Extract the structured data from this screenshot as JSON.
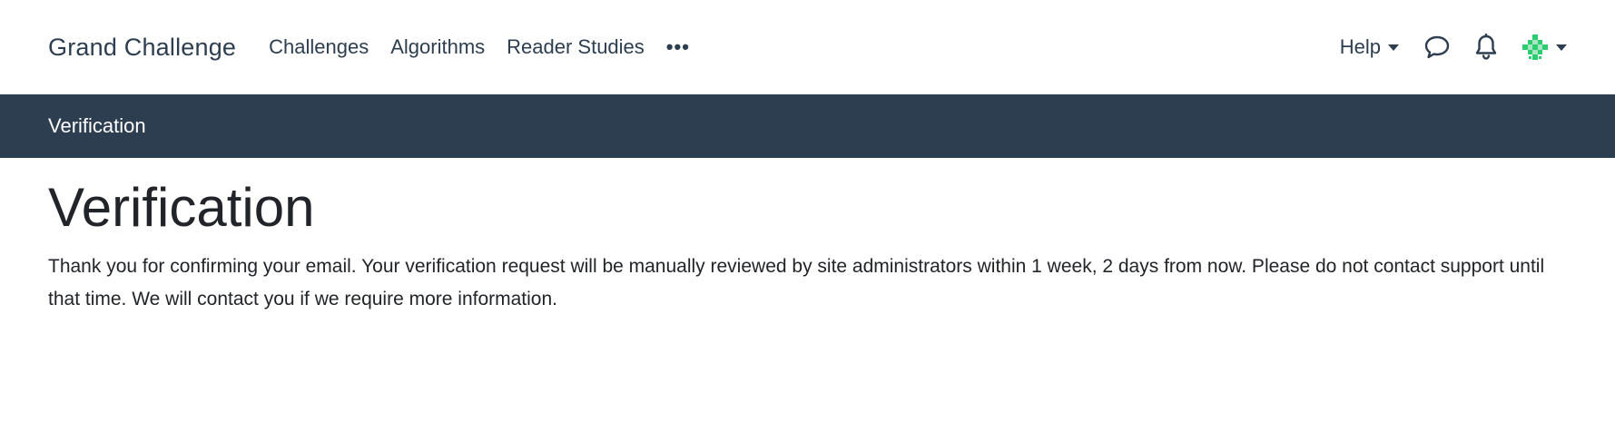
{
  "navbar": {
    "brand": "Grand Challenge",
    "links": [
      "Challenges",
      "Algorithms",
      "Reader Studies"
    ],
    "more": "•••",
    "help_label": "Help",
    "icons": {
      "forum": "chat-bubble-icon",
      "notifications": "bell-icon",
      "avatar": "user-avatar-icon"
    },
    "avatar_color": "#2ecc71"
  },
  "subbar": {
    "title": "Verification"
  },
  "main": {
    "title": "Verification",
    "message": "Thank you for confirming your email. Your verification request will be manually reviewed by site administrators within 1 week, 2 days from now. Please do not contact support until that time. We will contact you if we require more information."
  },
  "colors": {
    "primary": "#2c3e50",
    "text": "#212529",
    "background": "#ffffff"
  }
}
